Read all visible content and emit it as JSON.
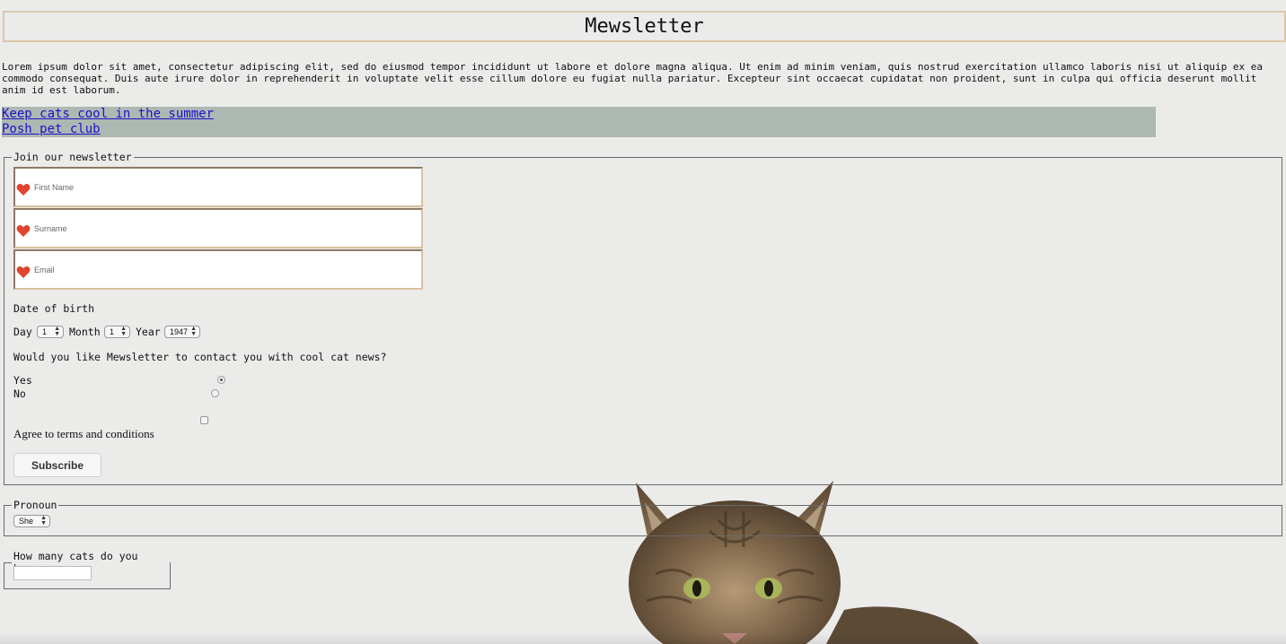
{
  "header": {
    "title": "Mewsletter"
  },
  "intro": {
    "text": "Lorem ipsum dolor sit amet, consectetur adipiscing elit, sed do eiusmod tempor incididunt ut labore et dolore magna aliqua. Ut enim ad minim veniam, quis nostrud exercitation ullamco laboris nisi ut aliquip ex ea commodo consequat. Duis aute irure dolor in reprehenderit in voluptate velit esse cillum dolore eu fugiat nulla pariatur. Excepteur sint occaecat cupidatat non proident, sunt in culpa qui officia deserunt mollit anim id est laborum."
  },
  "nav": {
    "links": [
      "Keep cats cool in the summer",
      "Posh pet club"
    ]
  },
  "newsletter": {
    "legend": "Join our newsletter",
    "fields": [
      {
        "placeholder": "First Name",
        "icon": "heart-icon"
      },
      {
        "placeholder": "Surname",
        "icon": "heart-icon"
      },
      {
        "placeholder": "Email",
        "icon": "heart-icon"
      }
    ],
    "dob_label": "Date of birth",
    "day_label": "Day",
    "day_value": "1",
    "month_label": "Month",
    "month_value": "1",
    "year_label": "Year",
    "year_value": "1947",
    "contact_question": "Would you like Mewsletter to contact you with cool cat news?",
    "yes_label": "Yes",
    "no_label": "No",
    "contact_selected": "Yes",
    "terms_label": "Agree to terms and conditions",
    "terms_checked": false,
    "subscribe_label": "Subscribe"
  },
  "pronoun": {
    "legend": "Pronoun",
    "value": "She"
  },
  "cats": {
    "legend": "How many cats do you have",
    "value": ""
  },
  "colors": {
    "heart": "#e0452f",
    "links_bg": "#aeb8b3",
    "link": "#1a12cc",
    "header_border": "#dcc7a9"
  }
}
